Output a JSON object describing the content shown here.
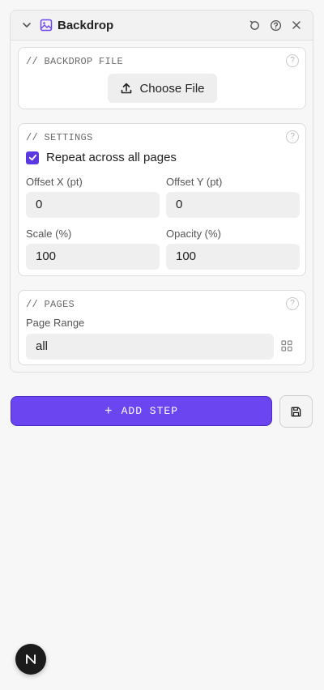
{
  "panel": {
    "title": "Backdrop",
    "icons": {
      "collapse": "chevron-down-icon",
      "type": "image-icon",
      "reset": "reset-icon",
      "help": "help-icon",
      "close": "close-icon"
    }
  },
  "backdrop_file": {
    "title": "// BACKDROP FILE",
    "help": "?",
    "choose_label": "Choose File"
  },
  "settings": {
    "title": "// SETTINGS",
    "help": "?",
    "repeat_label": "Repeat across all pages",
    "repeat_checked": true,
    "offset_x_label": "Offset X (pt)",
    "offset_x_value": "0",
    "offset_y_label": "Offset Y (pt)",
    "offset_y_value": "0",
    "scale_label": "Scale (%)",
    "scale_value": "100",
    "opacity_label": "Opacity (%)",
    "opacity_value": "100"
  },
  "pages": {
    "title": "// PAGES",
    "help": "?",
    "range_label": "Page Range",
    "range_value": "all"
  },
  "actions": {
    "add_step_label": "ADD STEP",
    "add_step_icon": "+"
  },
  "colors": {
    "accent": "#6b46f0",
    "checkbox": "#5a39e0"
  }
}
